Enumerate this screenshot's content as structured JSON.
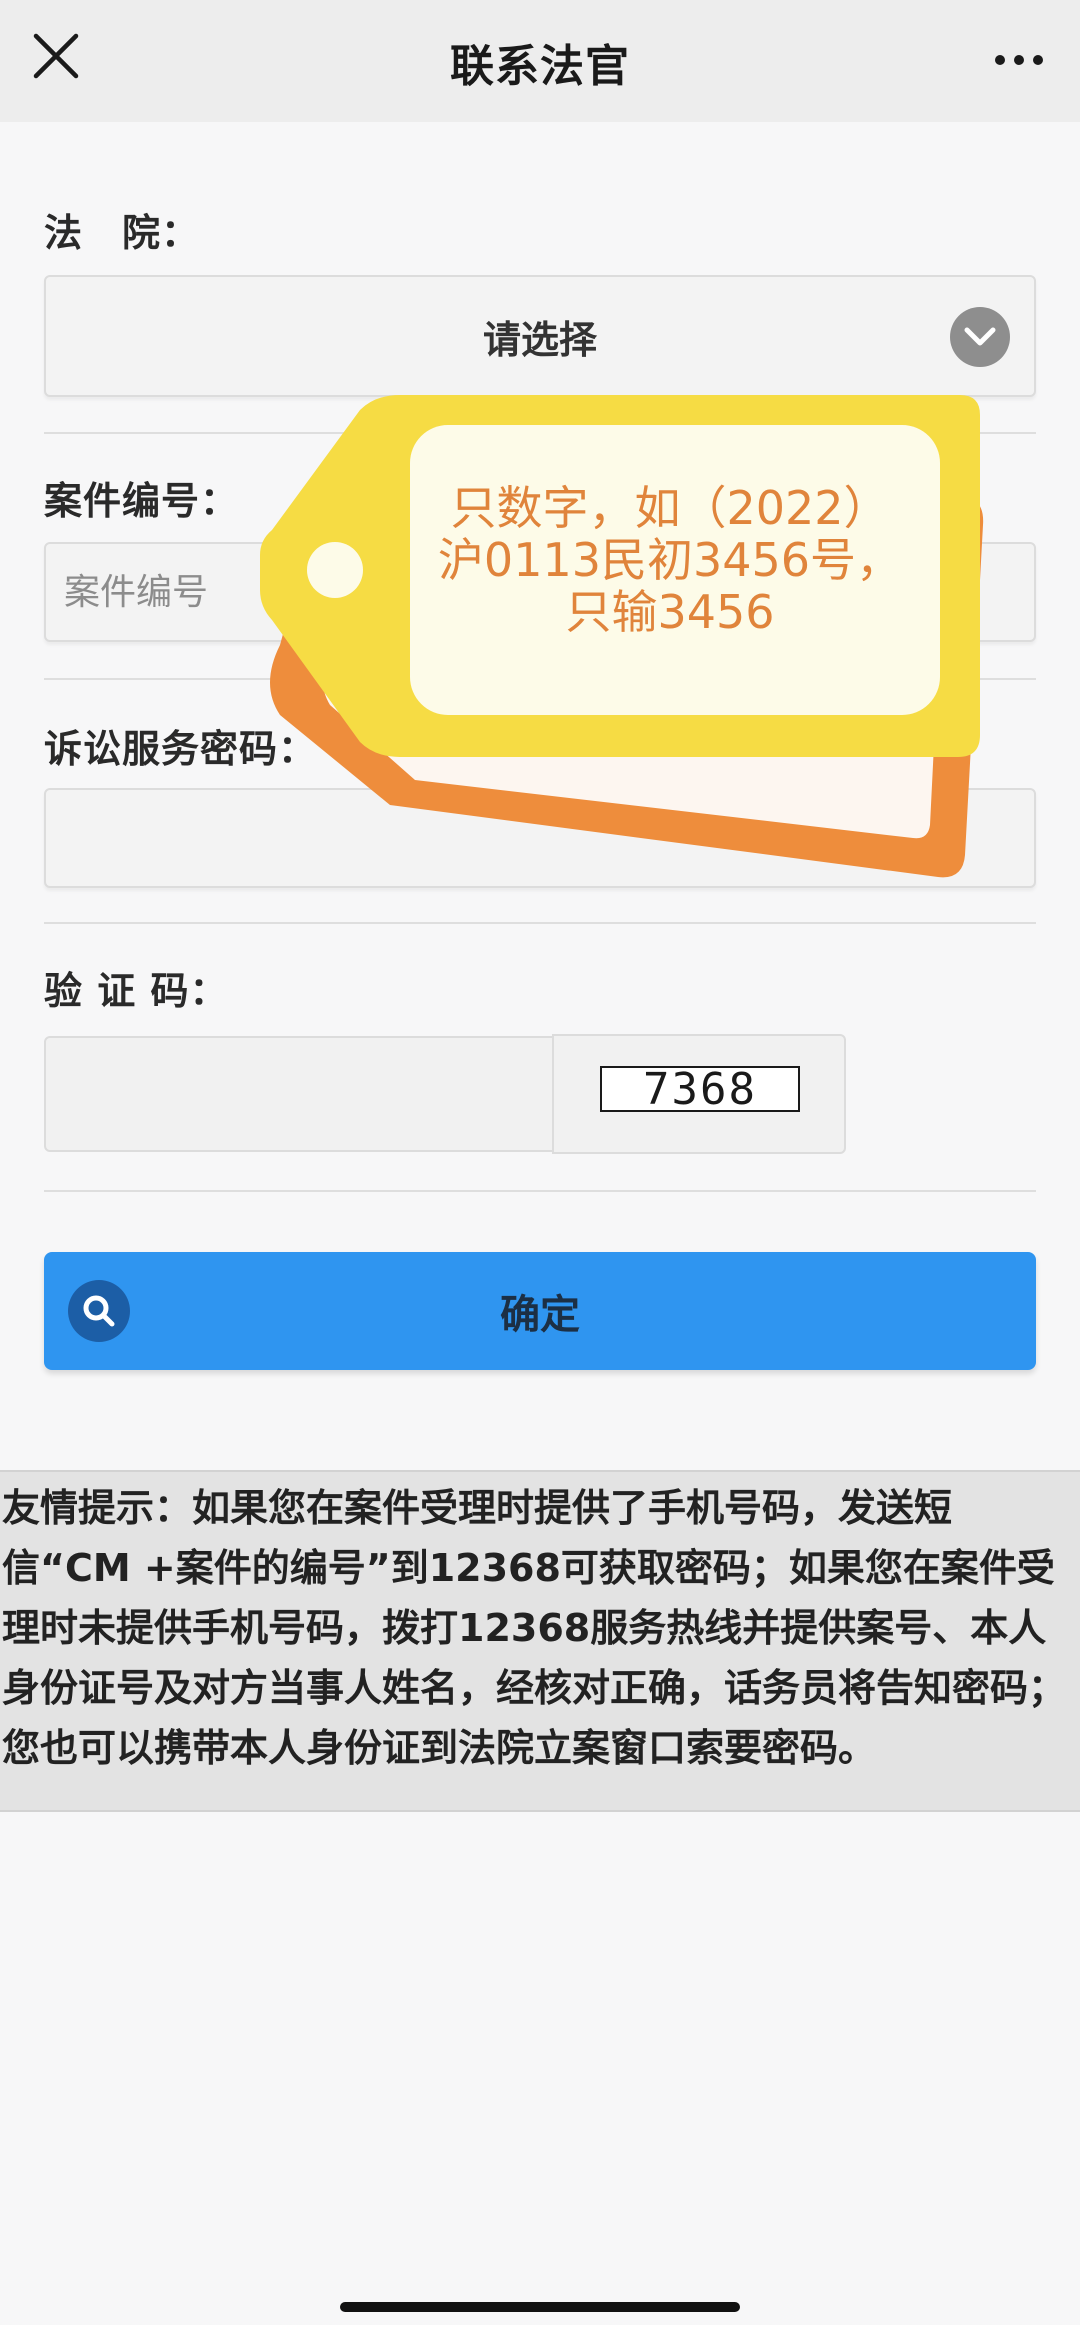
{
  "header": {
    "title": "联系法官"
  },
  "form": {
    "court_label": "法　院：",
    "court_select_value": "请选择",
    "case_number_label": "案件编号：",
    "case_number_placeholder": "案件编号",
    "password_label": "诉讼服务密码：",
    "captcha_label": "验 证 码：",
    "captcha_code": "7368",
    "confirm_label": "确定"
  },
  "tag_overlay": {
    "lines": [
      "只数字，如（2022）",
      "沪0113民初3456号，",
      "只输3456"
    ]
  },
  "tip": {
    "text": "友情提示：如果您在案件受理时提供了手机号码，发送短信“CM +案件的编号”到12368可获取密码；如果您在案件受理时未提供手机号码，拨打12368服务热线并提供案号、本人身份证号及对方当事人姓名，经核对正确，话务员将告知密码；您也可以携带本人身份证到法院立案窗口索要密码。"
  },
  "colors": {
    "accent": "#2f95f0",
    "tag_text": "#e0843b"
  }
}
